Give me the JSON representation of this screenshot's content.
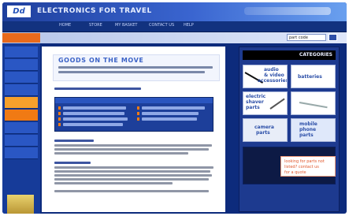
{
  "header": {
    "logo_text": "Dd",
    "site_title": "ELECTRONICS FOR TRAVEL"
  },
  "nav": {
    "items": [
      "HOME",
      "STORE",
      "MY BASKET",
      "CONTACT US",
      "HELP"
    ]
  },
  "search": {
    "value": "part code"
  },
  "main": {
    "page_title": "GOODS ON THE MOVE"
  },
  "right_panel": {
    "header_label": "CATEGORIES",
    "tiles": [
      {
        "label_line1": "audio",
        "label_line2": "& video",
        "label_line3": "accessories"
      },
      {
        "label_line1": "batteries",
        "label_line2": "",
        "label_line3": ""
      },
      {
        "label_line1": "electric",
        "label_line2": "shaver",
        "label_line3": "parts"
      },
      {
        "label_line1": "",
        "label_line2": "",
        "label_line3": ""
      },
      {
        "label_line1": "camera",
        "label_line2": "parts",
        "label_line3": ""
      },
      {
        "label_line1": "mobile",
        "label_line2": "phone",
        "label_line3": "parts"
      }
    ],
    "promo_lines": [
      "looking for parts not",
      "listed? contact us",
      "for a quote"
    ]
  },
  "colors": {
    "accent": "#f07a14",
    "brand": "#1d3a8f",
    "link": "#3c63c7"
  }
}
